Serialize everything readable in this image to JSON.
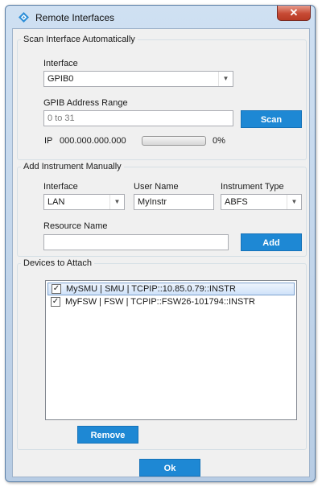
{
  "window": {
    "title": "Remote Interfaces",
    "close_glyph": "✕"
  },
  "scan": {
    "group_title": "Scan Interface Automatically",
    "interface_label": "Interface",
    "interface_value": "GPIB0",
    "address_label": "GPIB Address Range",
    "address_value": "0 to 31",
    "scan_button": "Scan",
    "ip_label": "IP",
    "ip_value": "000.000.000.000",
    "progress_percent": 0,
    "progress_text": "0%"
  },
  "manual": {
    "group_title": "Add Instrument Manually",
    "interface_label": "Interface",
    "interface_value": "LAN",
    "username_label": "User Name",
    "username_value": "MyInstr",
    "type_label": "Instrument Type",
    "type_value": "ABFS",
    "resource_label": "Resource Name",
    "resource_value": "",
    "add_button": "Add"
  },
  "devices": {
    "group_title": "Devices to Attach",
    "items": [
      {
        "label": "MySMU | SMU | TCPIP::10.85.0.79::INSTR",
        "checked": true,
        "selected": true
      },
      {
        "label": "MyFSW | FSW | TCPIP::FSW26-101794::INSTR",
        "checked": true,
        "selected": false
      }
    ],
    "remove_button": "Remove"
  },
  "footer": {
    "ok_button": "Ok"
  },
  "colors": {
    "accent": "#1e88d4",
    "title_bar": "#c4d6eb",
    "close": "#c74a34"
  },
  "icons": {
    "app": "diamond-icon",
    "combo_arrow": "chevron-down-icon",
    "check": "checkmark-icon"
  }
}
